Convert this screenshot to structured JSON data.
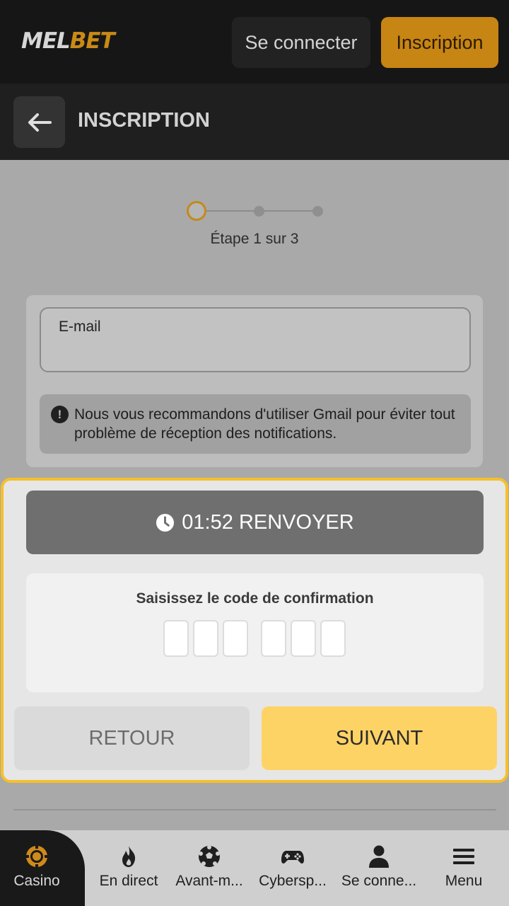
{
  "header": {
    "logo_part1": "MEL",
    "logo_part2": "BET",
    "login_label": "Se connecter",
    "register_label": "Inscription"
  },
  "subheader": {
    "title": "INSCRIPTION"
  },
  "stepper": {
    "current_step": 1,
    "total_steps": 3,
    "text": "Étape 1 sur 3"
  },
  "email_form": {
    "email_label": "E-mail",
    "email_value": "",
    "notice_icon": "exclamation-icon",
    "notice_text": "Nous vous recommandons d'utiliser Gmail pour éviter tout problème de réception des notifications."
  },
  "confirmation": {
    "timer": "01:52",
    "resend_label": "RENVOYER",
    "code_label": "Saisissez le code de confirmation",
    "code_digits": [
      "",
      "",
      "",
      "",
      "",
      ""
    ],
    "back_label": "RETOUR",
    "next_label": "SUIVANT"
  },
  "bottom_nav": {
    "items": [
      {
        "label": "Casino",
        "icon": "casino-chip-icon",
        "active": true
      },
      {
        "label": "En direct",
        "icon": "flame-icon"
      },
      {
        "label": "Avant-m...",
        "icon": "soccer-ball-icon"
      },
      {
        "label": "Cybersp...",
        "icon": "gamepad-icon"
      },
      {
        "label": "Se conne...",
        "icon": "user-icon"
      },
      {
        "label": "Menu",
        "icon": "hamburger-menu-icon"
      }
    ]
  },
  "colors": {
    "accent": "#c78514",
    "highlight_border": "#f6bf2c",
    "next_button": "#fed365",
    "header_bg": "#161616"
  }
}
